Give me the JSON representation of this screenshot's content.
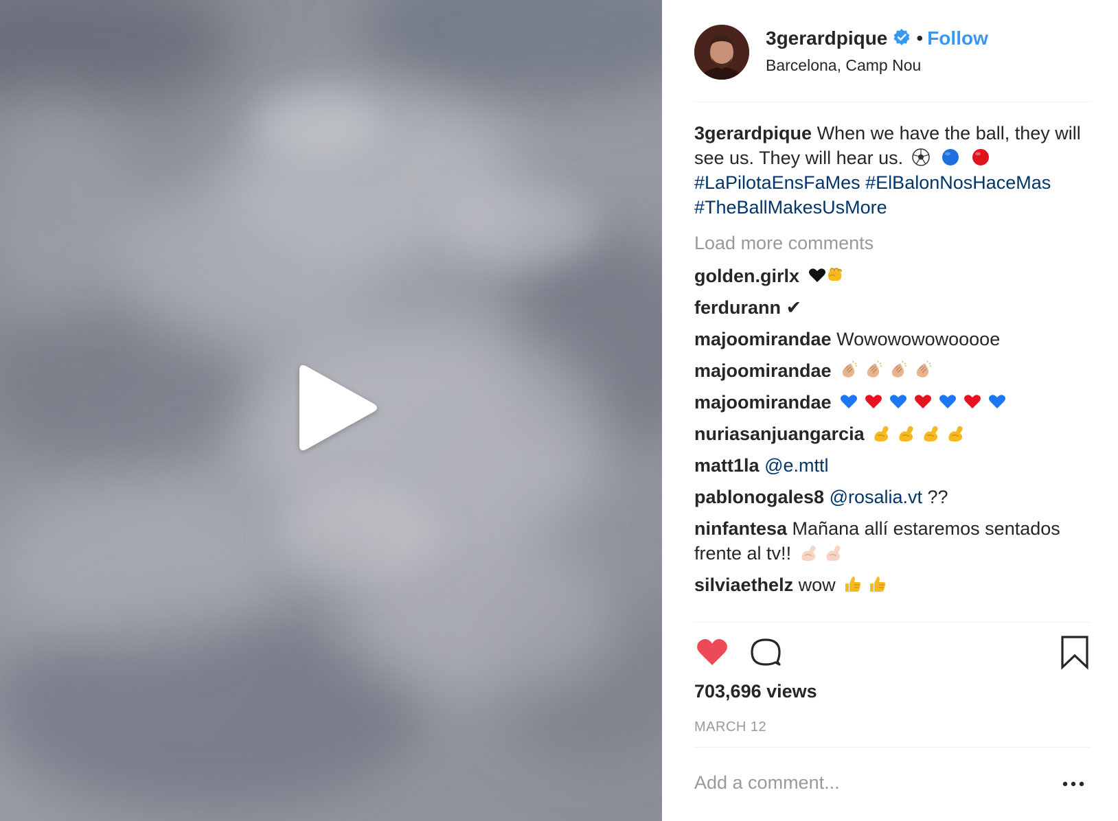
{
  "post": {
    "username": "3gerardpique",
    "verified": true,
    "follow_label": "Follow",
    "separator": "•",
    "location": "Barcelona, Camp Nou"
  },
  "caption": {
    "user": "3gerardpique",
    "text": "When we have the ball, they will see us. They will hear us.",
    "emojis": [
      "soccer-ball",
      "blue-circle",
      "red-circle"
    ],
    "hashtags": [
      "#LaPilotaEnsFaMes",
      "#ElBalonNosHaceMas",
      "#TheBallMakesUsMore"
    ]
  },
  "load_more_label": "Load more comments",
  "comments": [
    {
      "user": "golden.girlx",
      "text": "",
      "emojis": [
        "black-heart",
        "fist"
      ]
    },
    {
      "user": "ferdurann",
      "text": "✔",
      "emojis": []
    },
    {
      "user": "majoomirandae",
      "text": "Wowowowowooooe",
      "emojis": []
    },
    {
      "user": "majoomirandae",
      "text": "",
      "emojis": [
        "clap",
        "clap",
        "clap",
        "clap"
      ]
    },
    {
      "user": "majoomirandae",
      "text": "",
      "emojis": [
        "blue-heart",
        "red-heart",
        "blue-heart",
        "red-heart",
        "blue-heart",
        "red-heart",
        "blue-heart"
      ]
    },
    {
      "user": "nuriasanjuangarcia",
      "text": "",
      "emojis": [
        "flexed-biceps",
        "flexed-biceps",
        "flexed-biceps",
        "flexed-biceps"
      ]
    },
    {
      "user": "matt1la",
      "mention": "@e.mttl",
      "text": "",
      "emojis": []
    },
    {
      "user": "pablonogales8",
      "mention": "@rosalia.vt",
      "text": "??",
      "emojis": []
    },
    {
      "user": "ninfantesa",
      "text": "Mañana allí estaremos sentados frente al tv!!",
      "emojis": [
        "flexed-biceps-light",
        "flexed-biceps-light"
      ]
    },
    {
      "user": "silviaethelz",
      "text": "wow",
      "emojis": [
        "thumbs-up",
        "thumbs-up"
      ]
    }
  ],
  "actions": {
    "like_icon": "heart-filled-icon",
    "comment_icon": "comment-bubble-icon",
    "save_icon": "bookmark-icon",
    "liked": true
  },
  "views_label": "703,696 views",
  "date_label": "MARCH 12",
  "add_comment": {
    "placeholder": "Add a comment..."
  },
  "more_icon": "ellipsis-icon",
  "colors": {
    "link_blue": "#3897f0",
    "hashtag_blue": "#003569",
    "heart_red": "#ed4956",
    "muted": "#999999",
    "text": "#262626"
  }
}
